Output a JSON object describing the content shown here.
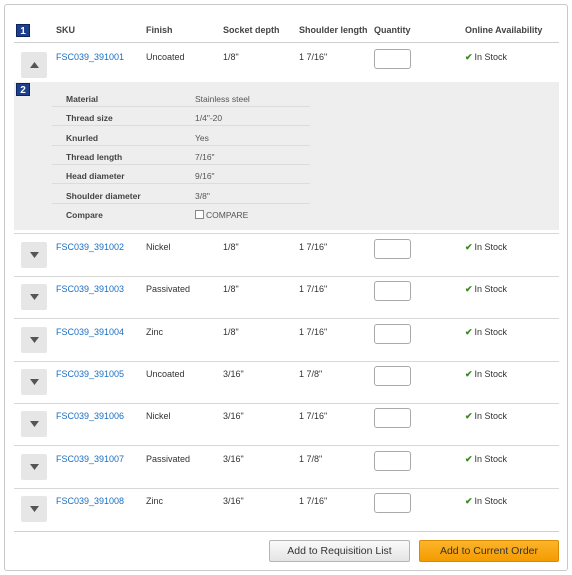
{
  "badges": {
    "row_badge": "1",
    "detail_badge": "2"
  },
  "headers": {
    "sku": "SKU",
    "finish": "Finish",
    "socket_depth": "Socket depth",
    "shoulder_length": "Shoulder length",
    "quantity": "Quantity",
    "availability": "Online Availability"
  },
  "rows": [
    {
      "sku": "FSC039_391001",
      "finish": "Uncoated",
      "socket_depth": "1/8\"",
      "shoulder_length": "1 7/16\"",
      "availability": "In Stock",
      "expanded": true
    },
    {
      "sku": "FSC039_391002",
      "finish": "Nickel",
      "socket_depth": "1/8\"",
      "shoulder_length": "1 7/16\"",
      "availability": "In Stock",
      "expanded": false
    },
    {
      "sku": "FSC039_391003",
      "finish": "Passivated",
      "socket_depth": "1/8\"",
      "shoulder_length": "1 7/16\"",
      "availability": "In Stock",
      "expanded": false
    },
    {
      "sku": "FSC039_391004",
      "finish": "Zinc",
      "socket_depth": "1/8\"",
      "shoulder_length": "1 7/16\"",
      "availability": "In Stock",
      "expanded": false
    },
    {
      "sku": "FSC039_391005",
      "finish": "Uncoated",
      "socket_depth": "3/16\"",
      "shoulder_length": "1 7/8\"",
      "availability": "In Stock",
      "expanded": false
    },
    {
      "sku": "FSC039_391006",
      "finish": "Nickel",
      "socket_depth": "3/16\"",
      "shoulder_length": "1 7/16\"",
      "availability": "In Stock",
      "expanded": false
    },
    {
      "sku": "FSC039_391007",
      "finish": "Passivated",
      "socket_depth": "3/16\"",
      "shoulder_length": "1 7/8\"",
      "availability": "In Stock",
      "expanded": false
    },
    {
      "sku": "FSC039_391008",
      "finish": "Zinc",
      "socket_depth": "3/16\"",
      "shoulder_length": "1 7/16\"",
      "availability": "In Stock",
      "expanded": false
    }
  ],
  "details": [
    {
      "label": "Material",
      "value": "Stainless steel"
    },
    {
      "label": "Thread size",
      "value": "1/4\"-20"
    },
    {
      "label": "Knurled",
      "value": "Yes"
    },
    {
      "label": "Thread length",
      "value": "7/16\""
    },
    {
      "label": "Head diameter",
      "value": "9/16\""
    },
    {
      "label": "Shoulder diameter",
      "value": "3/8\""
    },
    {
      "label": "Compare",
      "value": "COMPARE",
      "checkbox": true
    }
  ],
  "buttons": {
    "add_requisition": "Add to Requisition List",
    "add_order": "Add to Current Order"
  },
  "colors": {
    "badge": "#1d3f8c",
    "link": "#1a6ec2",
    "in_stock_check": "#3a8a1f",
    "primary_button": "#f59b00"
  },
  "icons": {
    "expand": "chevron-down-icon",
    "collapse": "chevron-up-icon",
    "stock": "checkmark-icon"
  }
}
